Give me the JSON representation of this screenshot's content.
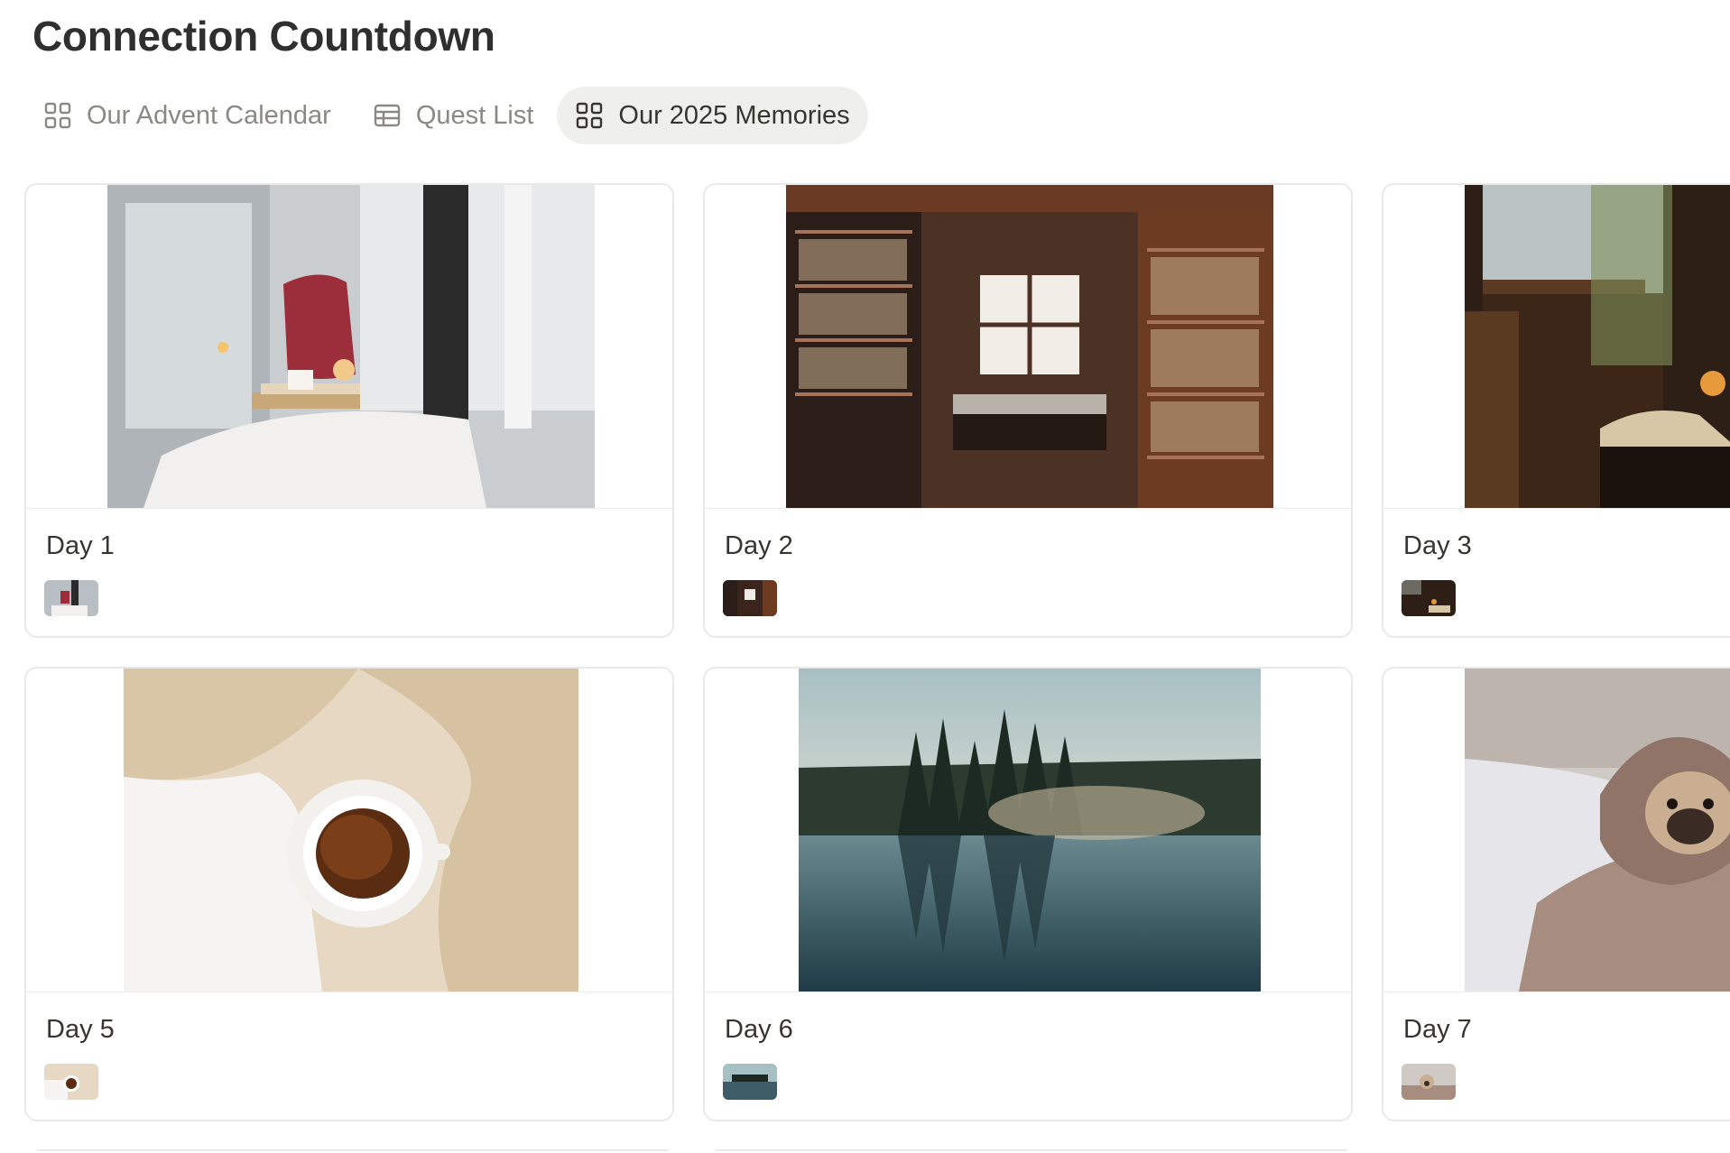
{
  "page": {
    "title": "Connection Countdown"
  },
  "tabs": [
    {
      "label": "Our Advent Calendar",
      "icon": "gallery-icon",
      "active": false
    },
    {
      "label": "Quest List",
      "icon": "table-icon",
      "active": false
    },
    {
      "label": "Our 2025 Memories",
      "icon": "gallery-icon",
      "active": true
    }
  ],
  "cards": [
    {
      "title": "Day 1",
      "image": "cozy-window-seat-with-candles-and-red-pillow"
    },
    {
      "title": "Day 2",
      "image": "bookshelf-nook-with-window"
    },
    {
      "title": "Day 3",
      "image": "dim-room-with-open-book-by-window"
    },
    {
      "title": "Day 5",
      "image": "tea-cup-on-cream-blankets"
    },
    {
      "title": "Day 6",
      "image": "misty-lake-with-pine-tree-reflection"
    },
    {
      "title": "Day 7",
      "image": "pug-wrapped-in-blanket-on-bed"
    }
  ]
}
